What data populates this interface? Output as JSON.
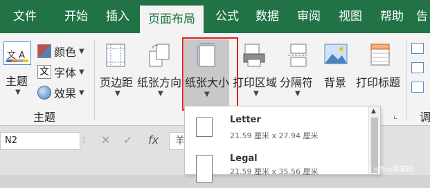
{
  "tabs": [
    "文件",
    "开始",
    "插入",
    "页面布局",
    "公式",
    "数据",
    "审阅",
    "视图",
    "帮助",
    "告"
  ],
  "ribbon": {
    "themes_big": "主题",
    "colors": "颜色",
    "fonts": "字体",
    "effects": "效果",
    "theme_icon_text": "文 A",
    "font_icon_text": "文",
    "group_themes": "主题",
    "margins": "页边距",
    "orientation": "纸张方向",
    "size": "纸张大小",
    "print_area": "打印区域",
    "breaks": "分隔符",
    "background": "背景",
    "print_titles": "打印标题",
    "group_setup_dialog_glyph": "⌞",
    "right_edge_label": "调"
  },
  "formula": {
    "name_box": "N2",
    "cancel_glyph": "✕",
    "confirm_glyph": "✓",
    "fx_glyph": "fx",
    "input_text": "羊"
  },
  "paper_sizes": [
    {
      "name": "Letter",
      "size": "21.59 厘米 x 27.94 厘米"
    },
    {
      "name": "Legal",
      "size": "21.59 厘米 x 35.56 厘米"
    }
  ],
  "watermark": "头条号 / office零基础",
  "colors": {
    "tab_green": "#217346",
    "highlight_red": "#e0211b"
  }
}
